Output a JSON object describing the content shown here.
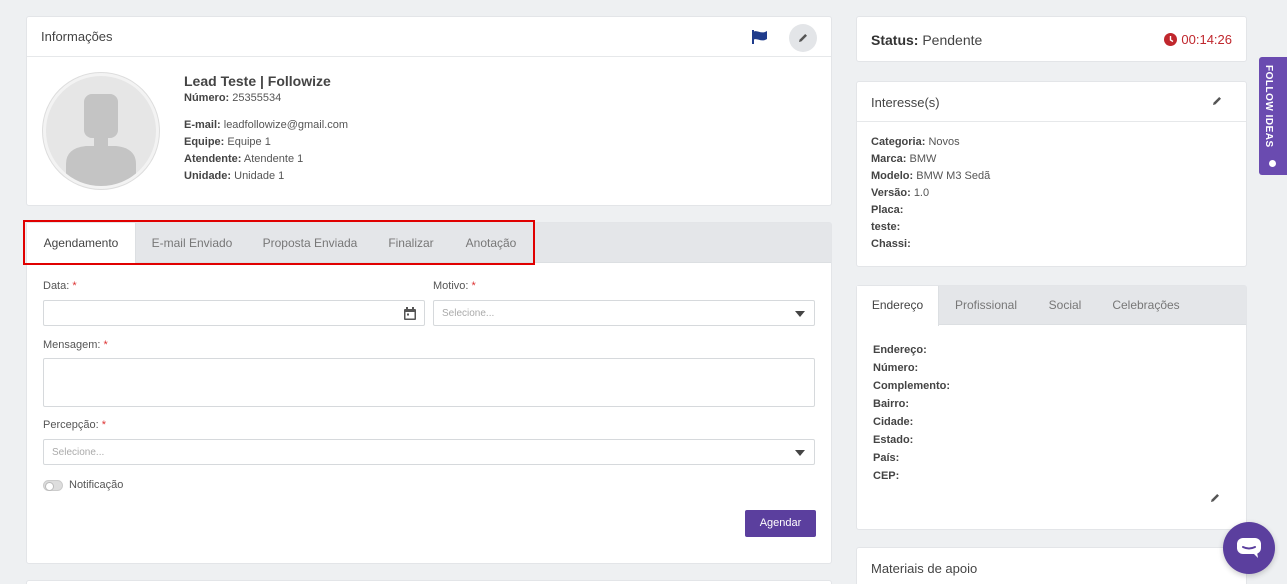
{
  "info": {
    "title": "Informações",
    "lead_name": "Lead Teste | Followize",
    "numero_label": "Número:",
    "numero_value": "25355534",
    "email_label": "E-mail:",
    "email_value": "leadfollowize@gmail.com",
    "equipe_label": "Equipe:",
    "equipe_value": "Equipe 1",
    "atendente_label": "Atendente:",
    "atendente_value": "Atendente 1",
    "unidade_label": "Unidade:",
    "unidade_value": "Unidade 1"
  },
  "tabs": [
    "Agendamento",
    "E-mail Enviado",
    "Proposta Enviada",
    "Finalizar",
    "Anotação"
  ],
  "form": {
    "data_label": "Data:",
    "motivo_label": "Motivo:",
    "motivo_placeholder": "Selecione...",
    "mensagem_label": "Mensagem:",
    "percepcao_label": "Percepção:",
    "percepcao_placeholder": "Selecione...",
    "required_mark": "*",
    "notificacao_label": "Notificação",
    "submit_label": "Agendar"
  },
  "status": {
    "label": "Status:",
    "value": "Pendente",
    "timer": "00:14:26",
    "timer_color": "#c0272d"
  },
  "interest": {
    "title": "Interesse(s)",
    "rows": [
      {
        "label": "Categoria:",
        "value": "Novos"
      },
      {
        "label": "Marca:",
        "value": "BMW"
      },
      {
        "label": "Modelo:",
        "value": "BMW M3 Sedã"
      },
      {
        "label": "Versão:",
        "value": "1.0"
      },
      {
        "label": "Placa:",
        "value": ""
      },
      {
        "label": "teste:",
        "value": ""
      },
      {
        "label": "Chassi:",
        "value": ""
      }
    ]
  },
  "address_tabs": [
    "Endereço",
    "Profissional",
    "Social",
    "Celebrações"
  ],
  "address_fields": [
    "Endereço:",
    "Número:",
    "Complemento:",
    "Bairro:",
    "Cidade:",
    "Estado:",
    "País:",
    "CEP:"
  ],
  "materials": {
    "title": "Materiais de apoio"
  },
  "side_tab": {
    "label": "FOLLOW IDEAS"
  },
  "colors": {
    "accent": "#5b3f9e",
    "side_tab": "#6a4bb0",
    "highlight": "#e00000"
  },
  "icons": [
    "flag-icon",
    "pencil-icon",
    "calendar-icon",
    "clock-icon",
    "chat-icon",
    "lightbulb-icon",
    "avatar-silhouette-icon"
  ]
}
